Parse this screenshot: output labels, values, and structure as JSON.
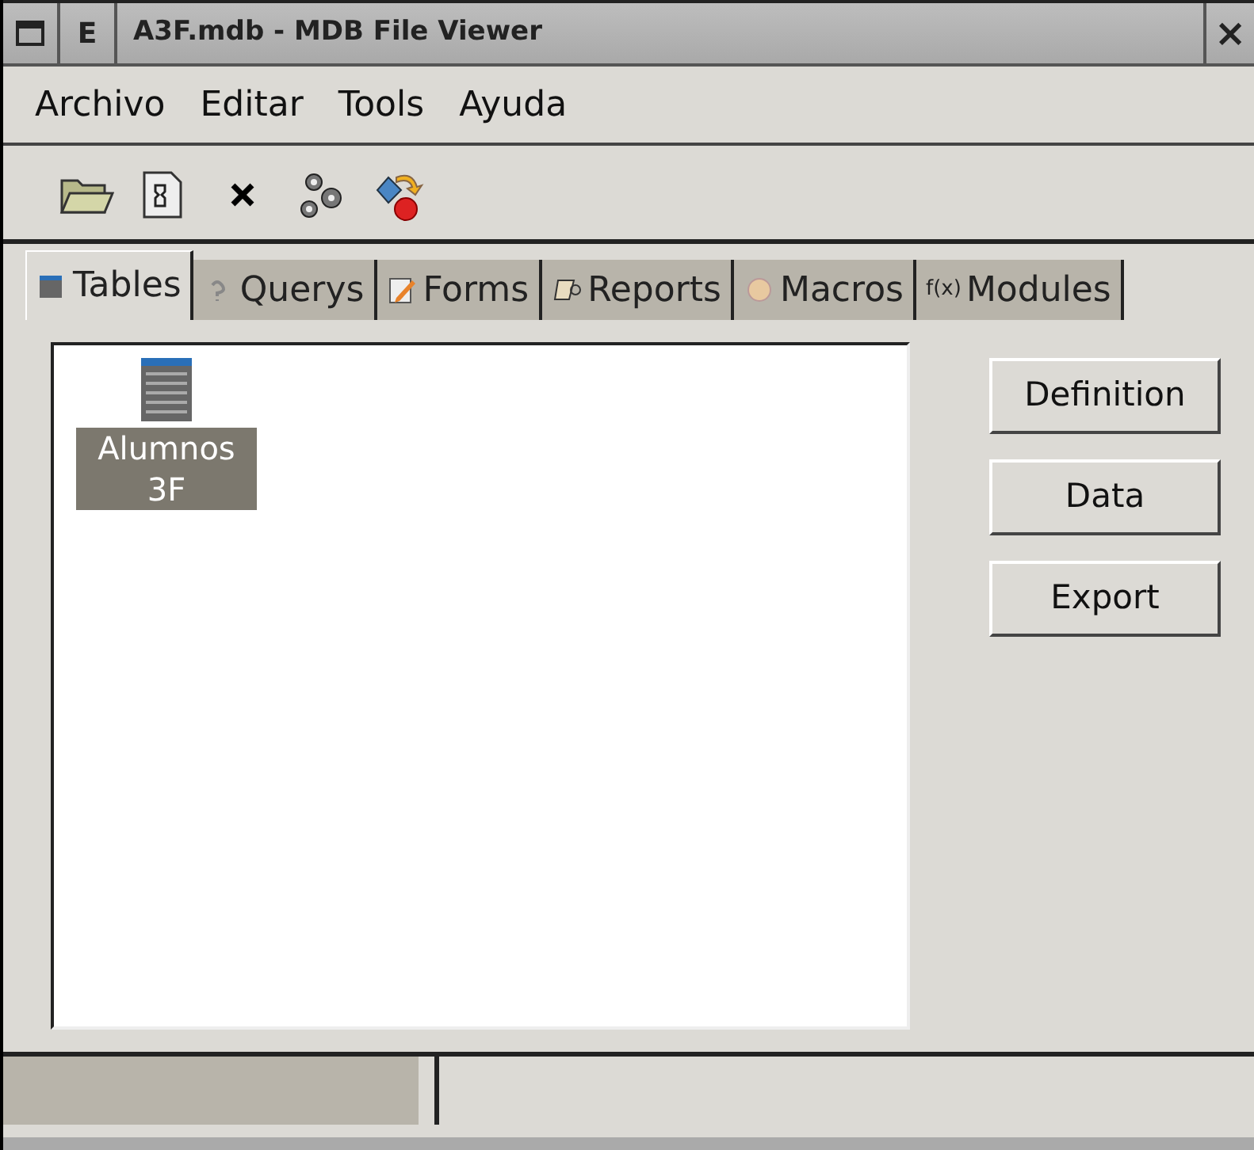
{
  "window": {
    "title": "A3F.mdb - MDB File Viewer",
    "menu_button": "E",
    "close": "×"
  },
  "menu": [
    {
      "label": "Archivo"
    },
    {
      "label": "Editar"
    },
    {
      "label": "Tools"
    },
    {
      "label": "Ayuda"
    }
  ],
  "toolbar": [
    {
      "kind": "open"
    },
    {
      "kind": "document"
    },
    {
      "kind": "delete"
    },
    {
      "kind": "gears"
    },
    {
      "kind": "shapes"
    }
  ],
  "tabs": [
    {
      "label": "Tables",
      "kind": "table",
      "selected": true
    },
    {
      "label": "Querys",
      "kind": "query",
      "selected": false
    },
    {
      "label": "Forms",
      "kind": "form",
      "selected": false
    },
    {
      "label": "Reports",
      "kind": "report",
      "selected": false
    },
    {
      "label": "Macros",
      "kind": "macro",
      "selected": false
    },
    {
      "label": "Modules",
      "kind": "module",
      "selected": false,
      "icon_text": "f(x)"
    }
  ],
  "items": [
    {
      "label": "Alumnos 3F",
      "selected": true
    }
  ],
  "buttons": [
    "Definition",
    "Data",
    "Export"
  ]
}
